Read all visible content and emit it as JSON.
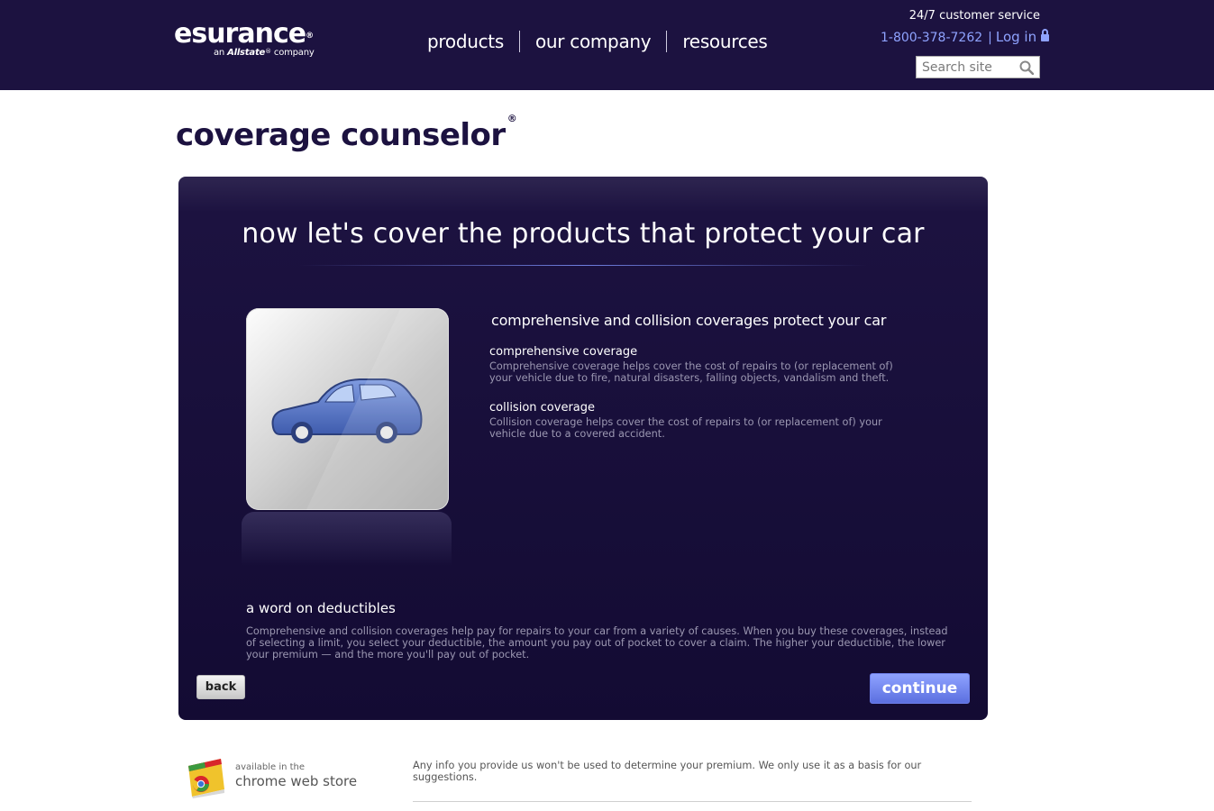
{
  "header": {
    "logo": {
      "name": "esurance",
      "reg_mark": "®",
      "sub_prefix": "an",
      "sub_brand": "Allstate",
      "sub_suffix": "company"
    },
    "nav": [
      {
        "label": "products"
      },
      {
        "label": "our company"
      },
      {
        "label": "resources"
      }
    ],
    "customer_service": "24/7 customer service",
    "phone": "1-800-378-7262",
    "separator": "|",
    "login_label": "Log in",
    "search": {
      "placeholder": "Search site",
      "value": ""
    }
  },
  "page": {
    "title": "coverage counselor",
    "title_mark": "®"
  },
  "panel": {
    "heading": "now let's cover the products that protect your car",
    "icon": "car-icon",
    "content_title": "comprehensive and collision coverages protect your car",
    "coverages": [
      {
        "title": "comprehensive coverage",
        "description": "Comprehensive coverage helps cover the cost of repairs to (or replacement of) your vehicle due to fire, natural disasters, falling objects, vandalism and theft."
      },
      {
        "title": "collision coverage",
        "description": "Collision coverage helps cover the cost of repairs to (or replacement of) your vehicle due to a covered accident."
      }
    ],
    "deductibles": {
      "title": "a word on deductibles",
      "text": "Comprehensive and collision coverages help pay for repairs to your car from a variety of causes. When you buy these coverages, instead of selecting a limit, you select your deductible, the amount you pay out of pocket to cover a claim. The higher your deductible, the lower your premium — and the more you'll pay out of pocket."
    },
    "back_label": "back",
    "continue_label": "continue"
  },
  "footer": {
    "chrome_small": "available in the",
    "chrome_big": "chrome web store",
    "disclaimer": "Any info you provide us won't be used to determine your premium. We only use it as a basis for our suggestions."
  },
  "colors": {
    "brand_navy": "#1c1240",
    "accent_blue": "#8fa3ff",
    "car_blue": "#4f6fbf"
  }
}
